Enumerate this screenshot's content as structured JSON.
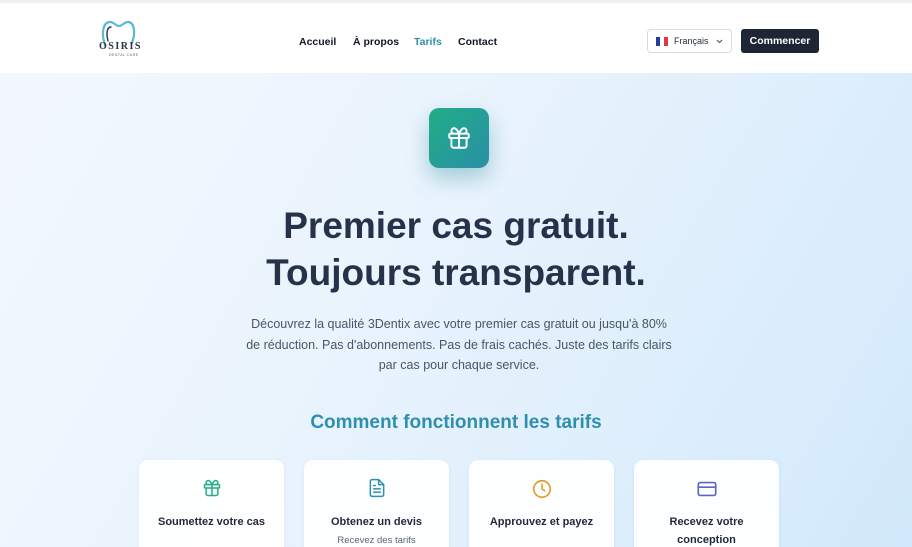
{
  "header": {
    "logo_text": "OSIRIS",
    "logo_sub": "DENTAL CARE",
    "nav": [
      {
        "label": "Accueil",
        "active": false
      },
      {
        "label": "À propos",
        "active": false
      },
      {
        "label": "Tarifs",
        "active": true
      },
      {
        "label": "Contact",
        "active": false
      }
    ],
    "language": {
      "label": "Français",
      "flag": "fr-flag-icon"
    },
    "cta_label": "Commencer"
  },
  "hero": {
    "icon": "gift-icon",
    "title_line1": "Premier cas gratuit.",
    "title_line2": "Toujours transparent.",
    "description": "Découvrez la qualité 3Dentix avec votre premier cas gratuit ou jusqu'à 80% de réduction. Pas d'abonnements. Pas de frais cachés. Juste des tarifs clairs par cas pour chaque service."
  },
  "section": {
    "title": "Comment fonctionnent les tarifs",
    "steps": [
      {
        "icon": "gift-icon",
        "color": "#1fae88",
        "title": "Soumettez votre cas",
        "subtitle": ""
      },
      {
        "icon": "document-icon",
        "color": "#2f8fae",
        "title": "Obtenez un devis",
        "subtitle": "Recevez des tarifs"
      },
      {
        "icon": "clock-icon",
        "color": "#e0a020",
        "title": "Approuvez et payez",
        "subtitle": ""
      },
      {
        "icon": "credit-card-icon",
        "color": "#5b64c8",
        "title": "Recevez votre conception",
        "subtitle": ""
      }
    ]
  },
  "colors": {
    "accent": "#2f8fae",
    "dark_button": "#1e2535",
    "title_text": "#25324a"
  }
}
